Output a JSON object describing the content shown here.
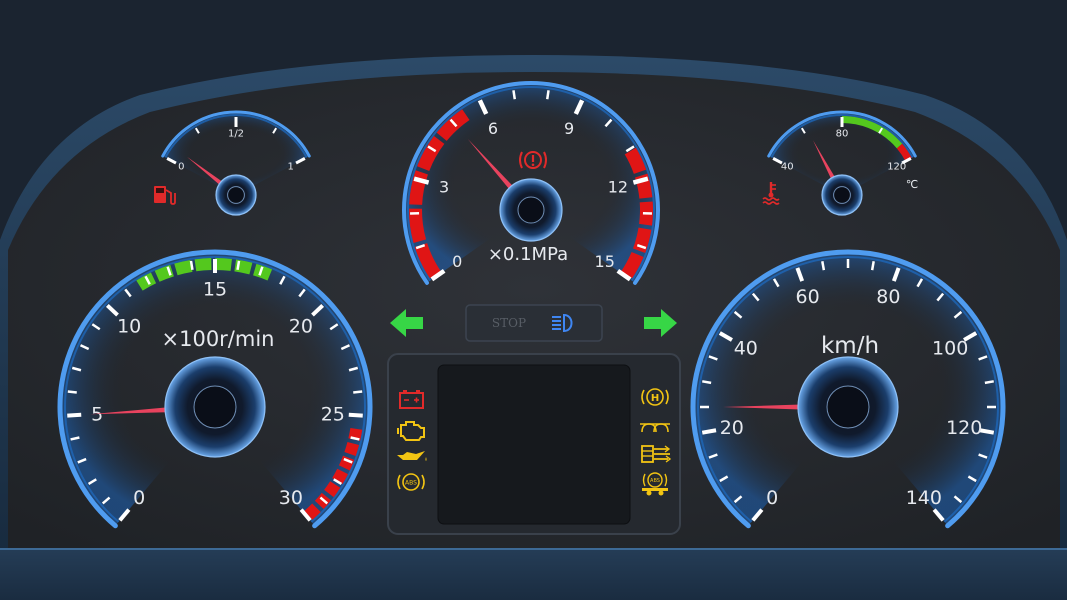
{
  "colors": {
    "ring": "#1e66b8",
    "ring_glow": "#4f9cf0",
    "needle": "#e8435e",
    "red_zone": "#e01515",
    "green_zone": "#54c81e",
    "arrow": "#37d646",
    "amber": "#f2c413",
    "warn_red": "#e12a2a",
    "beam_blue": "#3f86f2"
  },
  "fuel_gauge": {
    "labels": [
      "0",
      "1/2",
      "1"
    ],
    "level": 0.08,
    "icon": "fuel-pump-icon"
  },
  "pressure_gauge": {
    "labels": [
      "0",
      "3",
      "6",
      "9",
      "12",
      "15"
    ],
    "unit": "×0.1MPa",
    "value": 5.0,
    "icon": "brake-warning-icon"
  },
  "temp_gauge": {
    "labels": [
      "40",
      "80",
      "120"
    ],
    "unit": "℃",
    "value": 62,
    "icon": "coolant-temp-icon"
  },
  "tachometer": {
    "labels": [
      "0",
      "5",
      "10",
      "15",
      "20",
      "25",
      "30"
    ],
    "unit": "×100r/min",
    "value": 5.0
  },
  "speedometer": {
    "labels": [
      "0",
      "20",
      "40",
      "60",
      "80",
      "100",
      "120",
      "140"
    ],
    "unit": "km/h",
    "value": 25
  },
  "center_panel": {
    "stop_label": "STOP",
    "left_icons": [
      "battery-icon",
      "check-engine-icon",
      "oil-pressure-icon",
      "abs-icon"
    ],
    "right_icons": [
      "parking-brake-icon",
      "glow-plug-icon",
      "air-filter-icon",
      "trailer-abs-icon"
    ],
    "turn_left_icon": "turn-left-arrow-icon",
    "turn_right_icon": "turn-right-arrow-icon",
    "headlight_icon": "high-beam-icon"
  }
}
